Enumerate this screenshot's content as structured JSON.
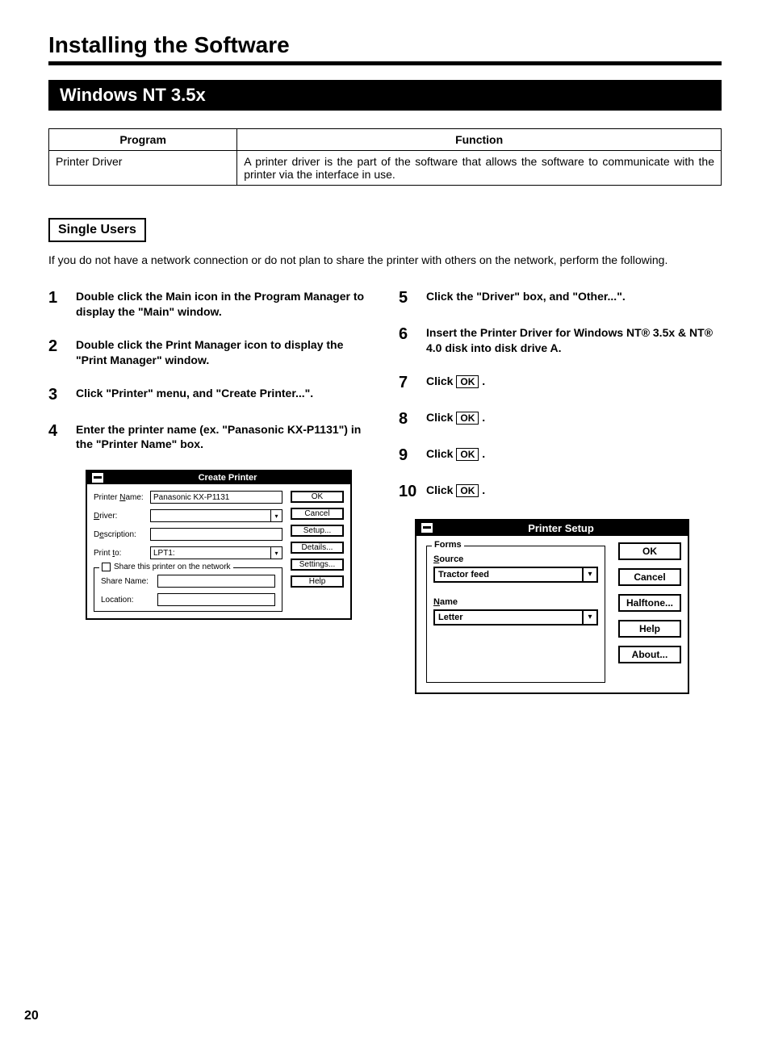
{
  "page_title": "Installing the Software",
  "section_banner": "Windows NT 3.5x",
  "table": {
    "headers": [
      "Program",
      "Function"
    ],
    "rows": [
      {
        "program": "Printer Driver",
        "function": "A printer driver is the part of the software that allows the software to communicate with the printer via the interface in use."
      }
    ]
  },
  "sub_heading": "Single Users",
  "intro": "If you do not have a network connection or do not plan to share the printer with others on the network, perform the following.",
  "steps_left": [
    {
      "n": "1",
      "t": "Double click the Main icon in the Program Manager to display the \"Main\" window."
    },
    {
      "n": "2",
      "t": "Double click the Print Manager icon to display the \"Print Manager\" window."
    },
    {
      "n": "3",
      "t": "Click \"Printer\" menu, and \"Create Printer...\"."
    },
    {
      "n": "4",
      "t": "Enter the printer name (ex. \"Panasonic KX-P1131\") in the \"Printer Name\" box."
    }
  ],
  "steps_right": [
    {
      "n": "5",
      "t": "Click the \"Driver\" box, and \"Other...\"."
    },
    {
      "n": "6",
      "t": "Insert the Printer Driver for Windows NT® 3.5x & NT® 4.0 disk into disk drive A."
    },
    {
      "n": "7",
      "t_pre": "Click ",
      "ok": "OK",
      "t_post": " ."
    },
    {
      "n": "8",
      "t_pre": "Click ",
      "ok": "OK",
      "t_post": " ."
    },
    {
      "n": "9",
      "t_pre": "Click ",
      "ok": "OK",
      "t_post": " ."
    },
    {
      "n": "10",
      "t_pre": "Click ",
      "ok": "OK",
      "t_post": " ."
    }
  ],
  "create_printer_dialog": {
    "title": "Create Printer",
    "fields": {
      "printer_name_label": "Printer Name:",
      "printer_name_value": "Panasonic KX-P1131",
      "driver_label": "Driver:",
      "driver_value": "",
      "description_label": "Description:",
      "description_value": "",
      "print_to_label": "Print to:",
      "print_to_value": "LPT1:"
    },
    "share_group": {
      "legend": "Share this printer on the network",
      "share_name_label": "Share Name:",
      "share_name_value": "",
      "location_label": "Location:",
      "location_value": ""
    },
    "buttons": {
      "ok": "OK",
      "cancel": "Cancel",
      "setup": "Setup...",
      "details": "Details...",
      "settings": "Settings...",
      "help": "Help"
    }
  },
  "printer_setup_dialog": {
    "title": "Printer Setup",
    "forms_legend": "Forms",
    "source_label": "Source",
    "source_value": "Tractor feed",
    "name_label": "Name",
    "name_value": "Letter",
    "buttons": {
      "ok": "OK",
      "cancel": "Cancel",
      "halftone": "Halftone...",
      "help": "Help",
      "about": "About..."
    }
  },
  "page_number": "20"
}
